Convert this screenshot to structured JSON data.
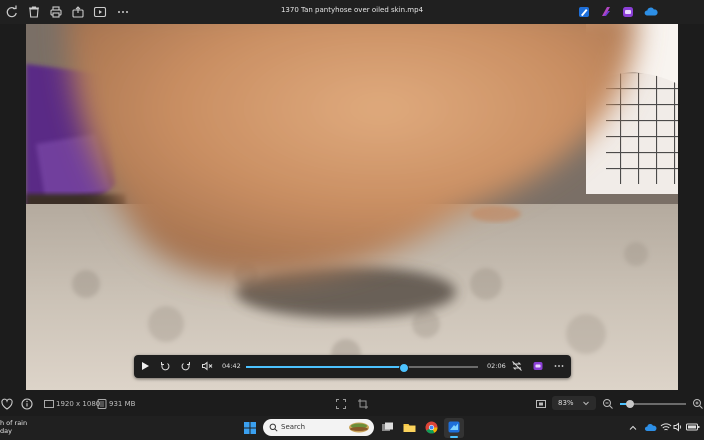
{
  "window": {
    "title": "1370 Tan pantyhose over oiled skin.mp4"
  },
  "toolbar": {
    "icons": [
      "rotate-icon",
      "delete-icon",
      "print-icon",
      "share-icon",
      "slideshow-icon",
      "more-icon"
    ],
    "right_icons": [
      "edit-app-icon",
      "clipchamp-icon",
      "designer-icon",
      "onedrive-icon"
    ]
  },
  "player": {
    "current_time": "04:42",
    "remaining_time": "02:06",
    "progress": 0.68
  },
  "status": {
    "resolution": "1920 x 1080",
    "file_size": "931 MB",
    "zoom_level": "83%"
  },
  "taskbar": {
    "search_placeholder": "Search",
    "weather_line1": "h of rain",
    "weather_line2": "day"
  }
}
